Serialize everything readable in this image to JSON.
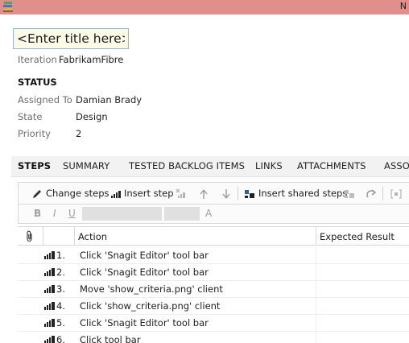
{
  "window": {
    "title_fragment": "N",
    "icon": "stacked-books-icon",
    "titlebar_color": "#e08f8c"
  },
  "work_item": {
    "title_placeholder": "<Enter title here>",
    "iteration_label": "Iteration",
    "iteration_value": "FabrikamFibre"
  },
  "status": {
    "heading": "STATUS",
    "fields": [
      {
        "label": "Assigned To",
        "value": "Damian Brady"
      },
      {
        "label": "State",
        "value": "Design"
      },
      {
        "label": "Priority",
        "value": "2"
      }
    ]
  },
  "tabs": [
    {
      "label": "STEPS",
      "active": true
    },
    {
      "label": "SUMMARY",
      "active": false
    },
    {
      "label": "TESTED BACKLOG ITEMS",
      "active": false
    },
    {
      "label": "LINKS",
      "active": false
    },
    {
      "label": "ATTACHMENTS",
      "active": false
    },
    {
      "label": "ASSOC",
      "active": false
    }
  ],
  "toolbar": {
    "change_steps": "Change steps",
    "insert_step": "Insert step",
    "insert_shared_steps": "Insert shared steps",
    "icons": [
      "pencil-icon",
      "insert-step-icon",
      "delete-step-icon",
      "move-up-icon",
      "move-down-icon",
      "insert-shared-steps-icon",
      "create-shared-steps-icon",
      "redo-icon",
      "parameter-icon"
    ]
  },
  "format_bar": {
    "bold": "B",
    "italic": "I",
    "underline": "U",
    "font_color": "A"
  },
  "grid": {
    "attachment_icon": "paperclip-icon",
    "col_action": "Action",
    "col_expected": "Expected Result",
    "steps": [
      {
        "number": "1.",
        "action": "Click 'Snagit Editor' tool bar"
      },
      {
        "number": "2.",
        "action": "Click 'Snagit Editor' tool bar"
      },
      {
        "number": "3.",
        "action": "Move 'show_criteria.png' client"
      },
      {
        "number": "4.",
        "action": "Click 'show_criteria.png' client"
      },
      {
        "number": "5.",
        "action": "Click 'Snagit Editor' tool bar"
      },
      {
        "number": "6.",
        "action": "Click tool bar"
      }
    ]
  }
}
